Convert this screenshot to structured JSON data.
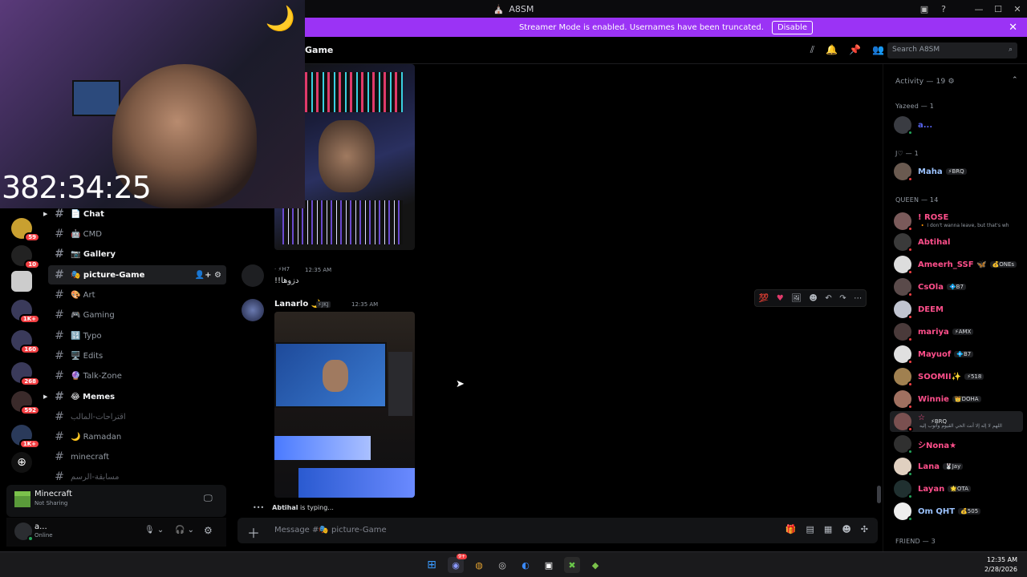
{
  "window": {
    "title": "A8SM",
    "controls": [
      "—",
      "☐",
      "✕"
    ]
  },
  "banner": {
    "text": "Streamer Mode is enabled. Usernames have been truncated.",
    "button": "Disable"
  },
  "header": {
    "channel": "Game",
    "search_placeholder": "Search A8SM"
  },
  "webcam": {
    "timer": "382:34:25"
  },
  "servers": [
    {
      "badge": "59"
    },
    {
      "badge": "10"
    },
    {
      "badge": ""
    },
    {
      "badge": "1K+"
    },
    {
      "badge": "160"
    },
    {
      "badge": "268"
    },
    {
      "badge": "592"
    },
    {
      "badge": "1K+"
    }
  ],
  "channels": [
    {
      "label": "📄 Chat",
      "style": "bold"
    },
    {
      "label": "🤖 CMD",
      "style": ""
    },
    {
      "label": "📷 Gallery",
      "style": "bold"
    },
    {
      "label": "🎭 picture-Game",
      "style": "active"
    },
    {
      "label": "🎨 Art",
      "style": ""
    },
    {
      "label": "🎮 Gaming",
      "style": ""
    },
    {
      "label": "🔢 Typo",
      "style": ""
    },
    {
      "label": "🖥️ Edits",
      "style": ""
    },
    {
      "label": "🔮 Talk-Zone",
      "style": ""
    },
    {
      "label": "😂 Memes",
      "style": "bold"
    },
    {
      "label": "اقتراحات-المالب",
      "style": "dim"
    },
    {
      "label": "🌙 Ramadan",
      "style": ""
    },
    {
      "label": "minecraft",
      "style": ""
    },
    {
      "label": "مسابقة-الرسم",
      "style": "dim"
    }
  ],
  "activity": {
    "game": "Minecraft",
    "status": "Not Sharing"
  },
  "user": {
    "name": "a...",
    "status": "Online"
  },
  "messages": [
    {
      "author": "",
      "tag": "⚡H7",
      "time": "12:35 AM",
      "text": "!!دزوها"
    },
    {
      "author": "Lanarlo 🌙",
      "tag": "⚡JKJ",
      "time": "12:35 AM",
      "text": ""
    }
  ],
  "typing": {
    "name": "Abtihal",
    "suffix": " is typing..."
  },
  "composer": {
    "placeholder": "Message #🎭 picture-Game"
  },
  "members": {
    "sections": [
      {
        "title": "Activity — 19 ⚙"
      },
      {
        "title": "Yazeed — 1"
      },
      {
        "title": "J♡ — 1"
      },
      {
        "title": "QUEEN — 14"
      },
      {
        "title": "FRIEND — 3"
      }
    ],
    "list": [
      {
        "name": "a...",
        "tag": "",
        "sub": "",
        "color": "#5865f2"
      },
      {
        "name": "Maha",
        "tag": "⚡BRQ",
        "sub": "",
        "color": "#9cc3ff"
      },
      {
        "name": "! ROSE",
        "tag": "",
        "sub": "🔸 I don't wanna leave, but that's wh",
        "color": "#ff4f8b"
      },
      {
        "name": "Abtihal",
        "tag": "",
        "sub": "",
        "color": "#ff4f8b"
      },
      {
        "name": "Ameerh_SSF 🦋",
        "tag": "💰ONEs",
        "sub": "",
        "color": "#ff4f8b"
      },
      {
        "name": "CsOla",
        "tag": "💠B7",
        "sub": "",
        "color": "#ff4f8b"
      },
      {
        "name": "DEEM",
        "tag": "",
        "sub": "",
        "color": "#ff4f8b"
      },
      {
        "name": "mariya",
        "tag": "⚡AMX",
        "sub": "",
        "color": "#ff4f8b"
      },
      {
        "name": "Mayuof",
        "tag": "💠B7",
        "sub": "",
        "color": "#ff4f8b"
      },
      {
        "name": "SOOMII✨",
        "tag": "⚡518",
        "sub": "",
        "color": "#ff4f8b"
      },
      {
        "name": "Winnie",
        "tag": "👑DOHA",
        "sub": "",
        "color": "#ff4f8b"
      },
      {
        "name": "☆",
        "tag": "⚡BRQ",
        "sub": "اللهم لا إله إلا أنت الحي القيوم وأتوب إليه",
        "color": "#ff4f8b"
      },
      {
        "name": "シNona★",
        "tag": "",
        "sub": "",
        "color": "#ff4f8b"
      },
      {
        "name": "Lana",
        "tag": "🐰Jay",
        "sub": "",
        "color": "#ff4f8b"
      },
      {
        "name": "Layan",
        "tag": "🌟OTA",
        "sub": "",
        "color": "#ff4f8b"
      },
      {
        "name": "Om QHT",
        "tag": "💰505",
        "sub": "",
        "color": "#9cc3ff"
      }
    ]
  },
  "clock": {
    "time": "12:35 AM",
    "date": "2/28/2026"
  },
  "taskbar": {
    "discord_badge": "9+"
  }
}
